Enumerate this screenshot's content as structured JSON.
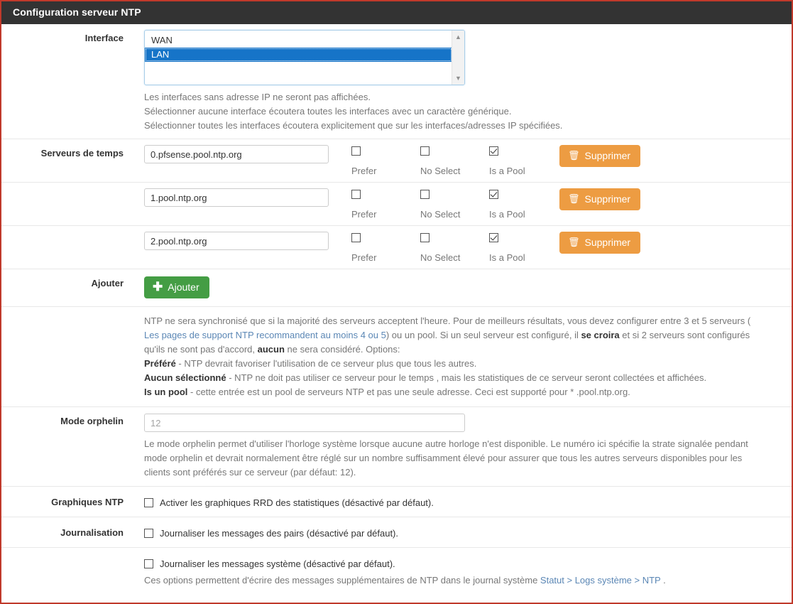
{
  "panel": {
    "title": "Configuration serveur NTP"
  },
  "interface": {
    "label": "Interface",
    "options": [
      {
        "label": "WAN",
        "selected": false
      },
      {
        "label": "LAN",
        "selected": true
      }
    ],
    "help": [
      "Les interfaces sans adresse IP ne seront pas affichées.",
      "Sélectionner aucune interface écoutera toutes les interfaces avec un caractère générique.",
      "Sélectionner toutes les interfaces écoutera explicitement que sur les interfaces/adresses IP spécifiées."
    ],
    "scroll_up_icon": "chevron-up-icon",
    "scroll_down_icon": "chevron-down-icon"
  },
  "time_servers": {
    "label": "Serveurs de temps",
    "checkbox_labels": {
      "prefer": "Prefer",
      "noselect": "No Select",
      "ispool": "Is a Pool"
    },
    "delete_label": "Supprimer",
    "delete_icon": "trash-icon",
    "rows": [
      {
        "value": "0.pfsense.pool.ntp.org",
        "prefer": false,
        "noselect": false,
        "ispool": true
      },
      {
        "value": "1.pool.ntp.org",
        "prefer": false,
        "noselect": false,
        "ispool": true
      },
      {
        "value": "2.pool.ntp.org",
        "prefer": false,
        "noselect": false,
        "ispool": true
      }
    ]
  },
  "add": {
    "label": "Ajouter",
    "button_label": "Ajouter",
    "icon": "plus-icon"
  },
  "ntp_help": {
    "line1_a": "NTP ne sera synchronisé que si la majorité des serveurs acceptent l'heure. Pour de meilleurs résultats, vous devez configurer entre 3 et 5 serveurs (",
    "link": "Les pages de support NTP recommandent au moins 4 ou 5",
    "line2_a": ") ou un pool. Si un seul serveur est configuré, il ",
    "bold1": "se croira",
    "line2_b": " et si 2 serveurs sont configurés",
    "line3_a": "qu'ils ne sont pas d'accord, ",
    "bold2": "aucun",
    "line3_b": " ne sera considéré. Options:",
    "opt1_bold": "Préféré",
    "opt1_text": " - NTP devrait favoriser l'utilisation de ce serveur plus que tous les autres.",
    "opt2_bold": "Aucun sélectionné",
    "opt2_text": " - NTP ne doit pas utiliser ce serveur pour le temps , mais les statistiques de ce serveur seront collectées et affichées.",
    "opt3_bold": "Is un pool",
    "opt3_text": " - cette entrée est un pool de serveurs NTP et pas une seule adresse. Ceci est supporté pour * .pool.ntp.org."
  },
  "orphan": {
    "label": "Mode orphelin",
    "placeholder": "12",
    "value": "",
    "help_line1": "Le mode orphelin permet d'utiliser l'horloge système lorsque aucune autre horloge n'est disponible. Le numéro ici spécifie la strate signalée pendant",
    "help_line2": "mode orphelin et devrait normalement être réglé sur un nombre suffisamment élevé pour assurer que tous les autres serveurs disponibles pour les",
    "help_line3": "clients sont préférés sur ce serveur (par défaut: 12)."
  },
  "graphs": {
    "label": "Graphiques NTP",
    "checkbox_label": "Activer les graphiques RRD des statistiques (désactivé par défaut).",
    "checked": false
  },
  "logging": {
    "label": "Journalisation",
    "peer_checkbox_label": "Journaliser les messages des pairs (désactivé par défaut).",
    "peer_checked": false,
    "sys_checkbox_label": "Journaliser les messages système (désactivé par défaut).",
    "sys_checked": false,
    "help_prefix": "Ces options permettent d'écrire des messages supplémentaires de NTP dans le journal système ",
    "help_link": "Statut > Logs système > NTP",
    "help_suffix": " ."
  },
  "colors": {
    "header_bg": "#333333",
    "frame_border": "#c0392b",
    "danger": "#ed9c42",
    "success": "#449d44",
    "link": "#5b87b5",
    "select_highlight": "#1674c8"
  }
}
